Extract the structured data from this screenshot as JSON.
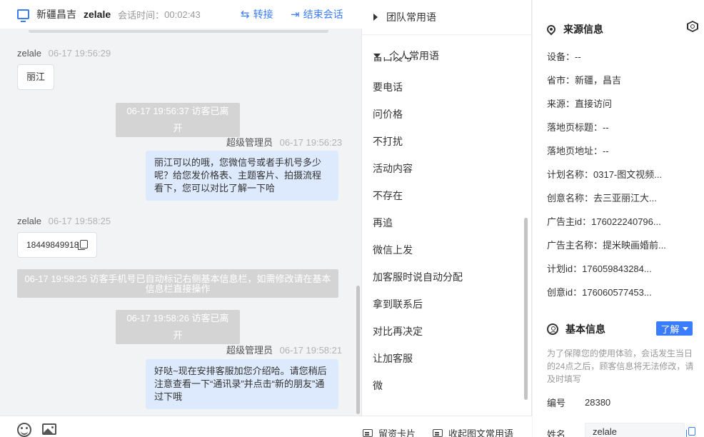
{
  "header": {
    "location": "新疆昌吉",
    "user": "zelale",
    "time_label": "会话时间：",
    "time": "00:02:43",
    "transfer_label": "转接",
    "end_label": "结束会话"
  },
  "messages": {
    "m1": {
      "name": "zelale",
      "ts": "06-17 19:56:29",
      "text": "丽江"
    },
    "s1": "06-17 19:56:37 访客已离开",
    "m2": {
      "name": "超级管理员",
      "ts": "06-17 19:56:23",
      "text": "丽江可以的哦，您微信号或者手机号多少呢？给您发价格表、主题客片、拍摄流程看下，您可以对比了解一下哈"
    },
    "m3": {
      "name": "zelale",
      "ts": "06-17 19:58:25",
      "text": "18449849918"
    },
    "s2": "06-17 19:58:25 访客手机号已自动标记右侧基本信息栏，如需修改请在基本信息栏直接操作",
    "s3": "06-17 19:58:26 访客已离开",
    "m4": {
      "name": "超级管理员",
      "ts": "06-17 19:58:21",
      "text": "好哒~现在安排客服加您介绍哈。请您稍后注意查看一下“通讯录”并点击“新的朋友”通过下哦"
    }
  },
  "phrases": {
    "team_label": "团队常用语",
    "personal_label": "个人常用语",
    "cut_item": "留口发号",
    "items": [
      "要电话",
      "问价格",
      "不打扰",
      "活动内容",
      "不存在",
      "再追",
      "微信上发",
      "加客服时说自动分配",
      "拿到联系后",
      "对比再决定",
      "让加客服",
      "微"
    ],
    "card_label": "留资卡片",
    "collapse_label": "收起图文常用语"
  },
  "source": {
    "title": "来源信息",
    "rows": [
      "设备：--",
      "省市：新疆，昌吉",
      "来源：直接访问",
      "落地页标题：--",
      "落地页地址：--",
      "计划名称：0317-图文视频...",
      "创意名称：去三亚丽江大...",
      "广告主id：176022240796...",
      "广告主名称：提米映画婚前...",
      "计划id：176059843284...",
      "创意id：176060577453..."
    ]
  },
  "basic": {
    "title": "基本信息",
    "know_label": "了解",
    "note": "为了保障您的使用体验，会话发生当日的24点之后，顾客信息将无法修改，请及时填写",
    "id_label": "编号",
    "id_value": "28380",
    "name_label": "姓名",
    "name_value": "zelale"
  },
  "colors": {
    "accent": "#3a7cff",
    "bubble_out": "#dde9fd",
    "system": "#d4d4d4"
  }
}
